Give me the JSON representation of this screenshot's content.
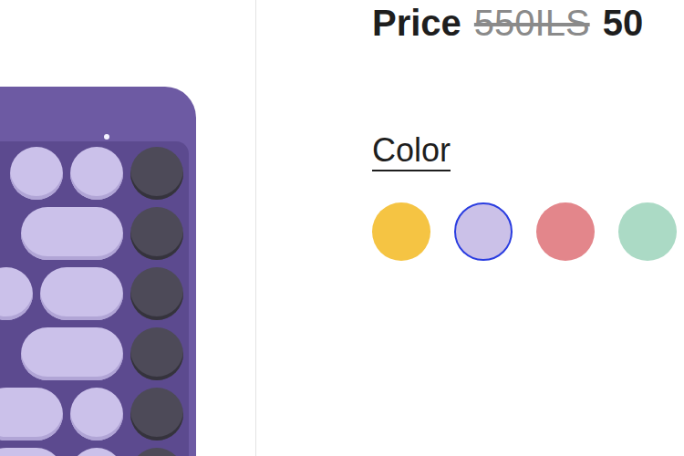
{
  "price": {
    "label": "Price",
    "original": "550ILS",
    "current": "50"
  },
  "color_picker": {
    "label": "Color",
    "swatches": [
      {
        "color": "#f5c443",
        "selected": false
      },
      {
        "color": "#cbc1e8",
        "selected": true
      },
      {
        "color": "#e3868b",
        "selected": false
      },
      {
        "color": "#abdac5",
        "selected": false
      }
    ]
  }
}
